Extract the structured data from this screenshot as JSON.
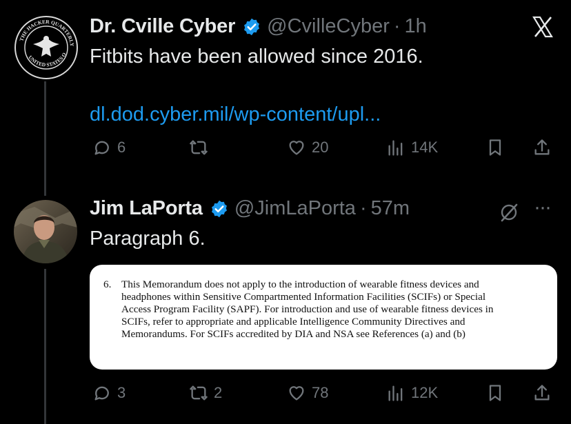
{
  "close_icon": "x-icon",
  "tweet1": {
    "avatar_text": "THE HACKER QUARTERLY · UNITED STATES OF AMERICA",
    "name": "Dr. Cville Cyber",
    "handle": "@CvilleCyber",
    "separator": "·",
    "time": "1h",
    "text": "Fitbits have been allowed since 2016.",
    "link": "dl.dod.cyber.mil/wp-content/upl...",
    "replies": "6",
    "retweets": "",
    "likes": "20",
    "views": "14K"
  },
  "tweet2": {
    "name": "Jim LaPorta",
    "handle": "@JimLaPorta",
    "separator": "·",
    "time": "57m",
    "text": "Paragraph 6.",
    "more": "···",
    "replies": "3",
    "retweets": "2",
    "likes": "78",
    "views": "12K",
    "document": {
      "number": "6.",
      "lines": [
        "This Memorandum does not apply to the introduction of wearable fitness devices and",
        "headphones within Sensitive Compartmented Information Facilities (SCIFs) or Special",
        "Access Program Facility (SAPF).  For introduction and use of wearable fitness devices in",
        "SCIFs, refer to appropriate and applicable Intelligence Community Directives and",
        "Memorandums.  For SCIFs accredited by DIA and NSA see References (a) and (b)"
      ]
    }
  },
  "colors": {
    "background": "#000000",
    "text": "#e7e9ea",
    "muted": "#71767b",
    "link": "#1d9bf0",
    "verified": "#1d9bf0"
  }
}
